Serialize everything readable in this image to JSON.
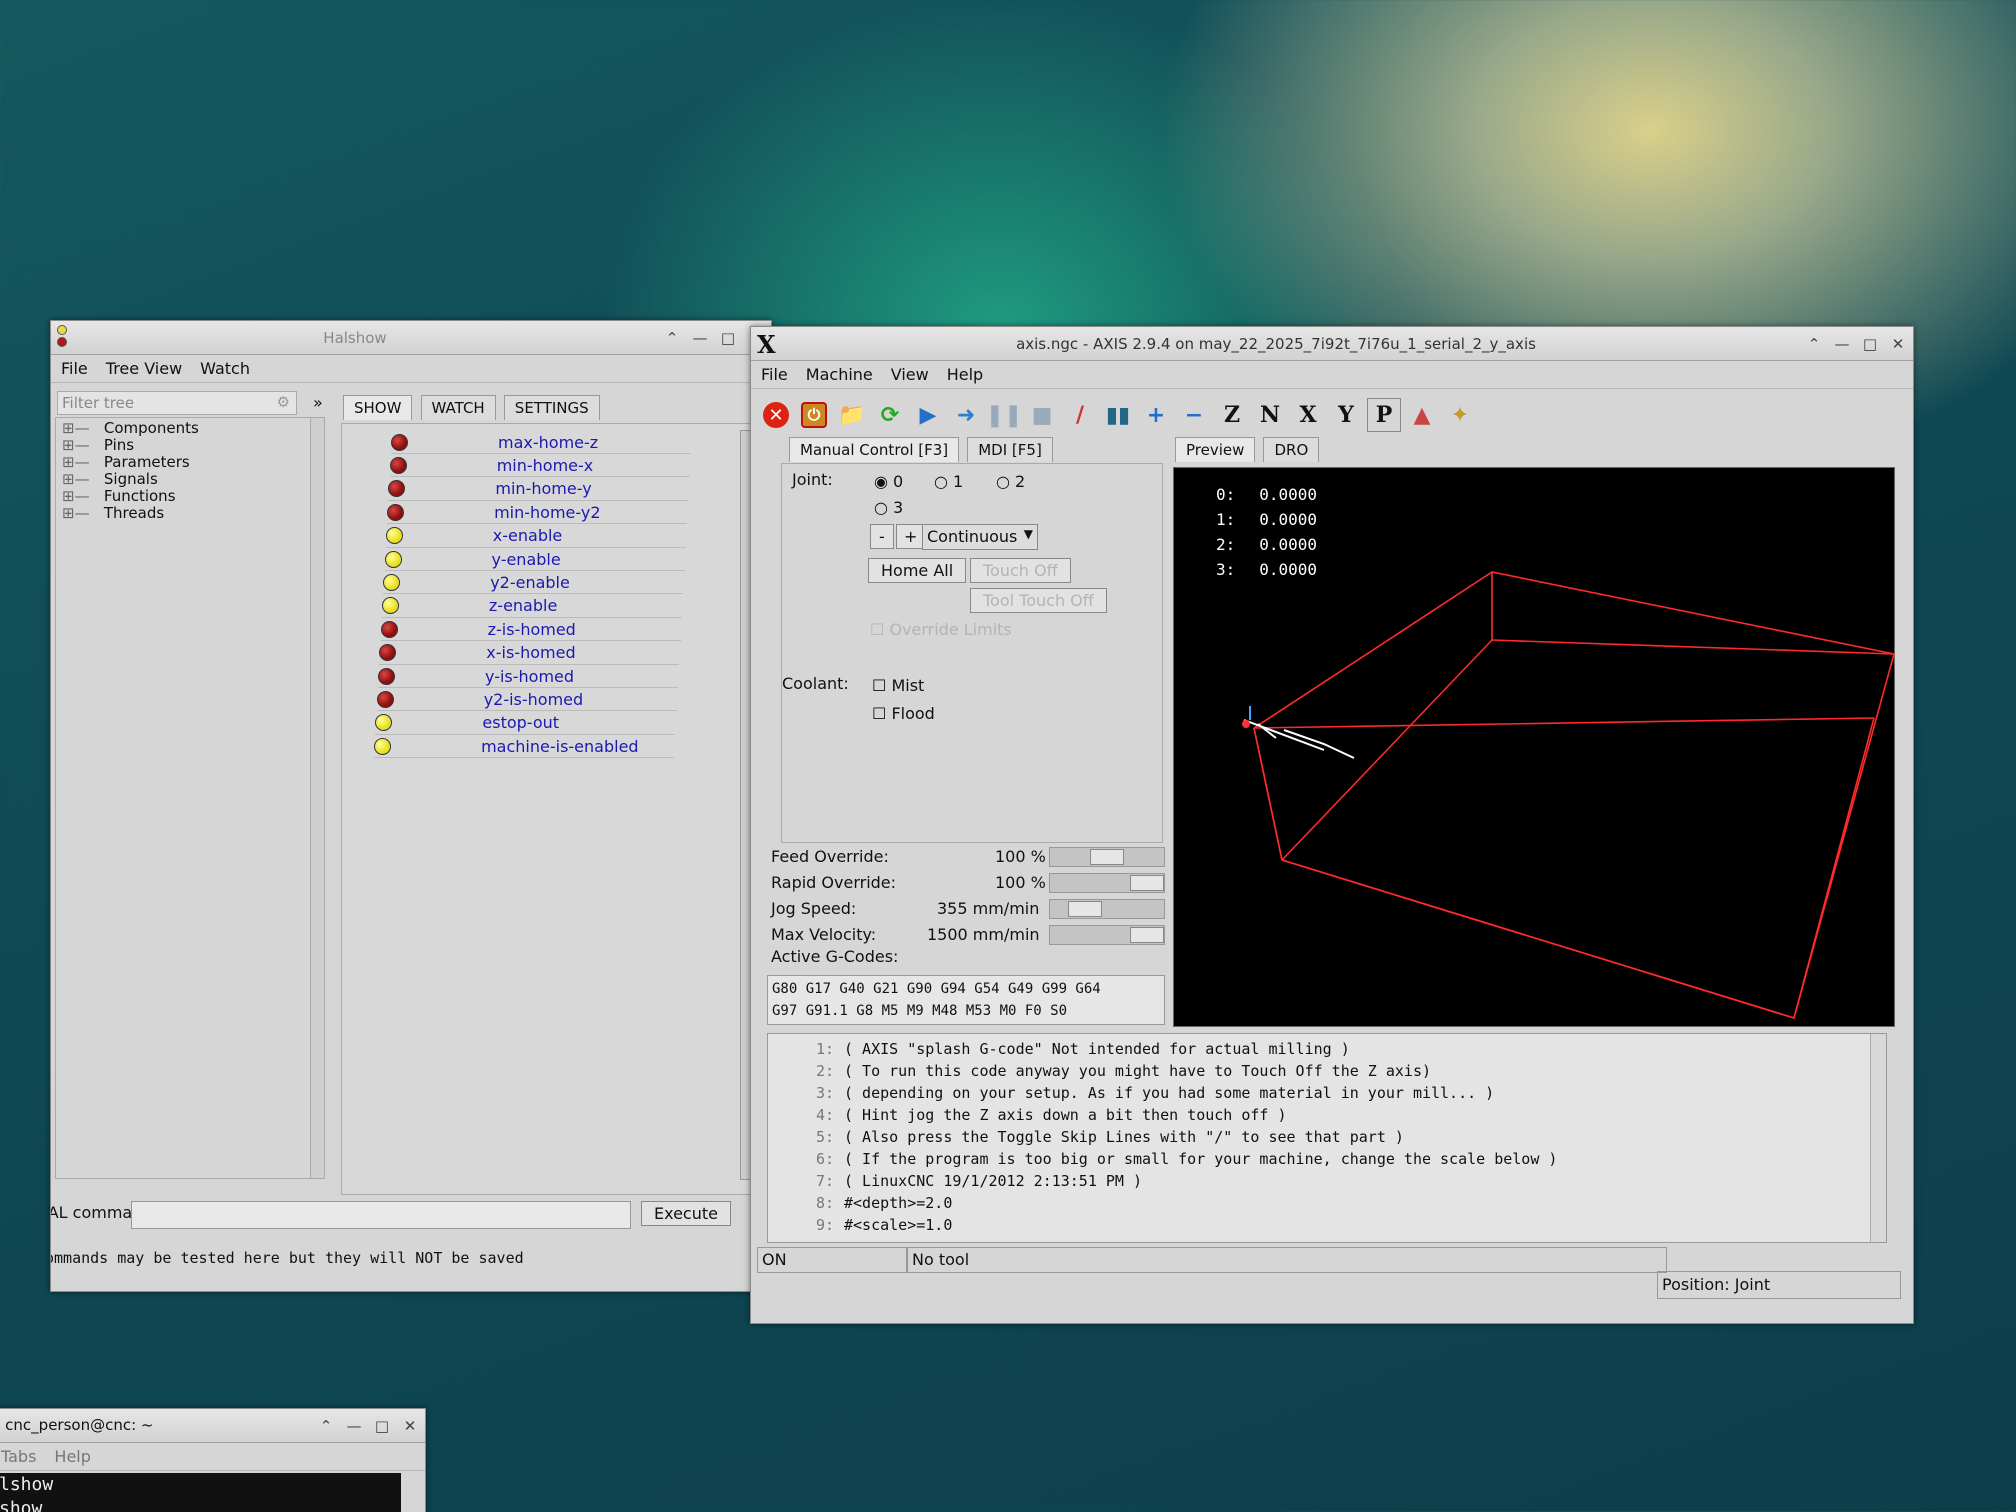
{
  "halshow": {
    "title": "Halshow",
    "menu": [
      "File",
      "Tree View",
      "Watch"
    ],
    "filter_placeholder": "Filter tree",
    "expand_glyph": "»",
    "tree": [
      "Components",
      "Pins",
      "Parameters",
      "Signals",
      "Functions",
      "Threads"
    ],
    "tabs": [
      "SHOW",
      "WATCH",
      "SETTINGS"
    ],
    "pins": [
      {
        "name": "max-home-z",
        "state": "red"
      },
      {
        "name": "min-home-x",
        "state": "red"
      },
      {
        "name": "min-home-y",
        "state": "red"
      },
      {
        "name": "min-home-y2",
        "state": "red"
      },
      {
        "name": "x-enable",
        "state": "yellow"
      },
      {
        "name": "y-enable",
        "state": "yellow"
      },
      {
        "name": "y2-enable",
        "state": "yellow"
      },
      {
        "name": "z-enable",
        "state": "yellow"
      },
      {
        "name": "z-is-homed",
        "state": "red"
      },
      {
        "name": "x-is-homed",
        "state": "red"
      },
      {
        "name": "y-is-homed",
        "state": "red"
      },
      {
        "name": "y2-is-homed",
        "state": "red"
      },
      {
        "name": "estop-out",
        "state": "yellow"
      },
      {
        "name": "machine-is-enabled",
        "state": "yellow"
      }
    ],
    "command_label": "IAL command :",
    "execute_label": "Execute",
    "status_text": "ommands may be tested here but they will NOT be saved"
  },
  "axis": {
    "title": "axis.ngc - AXIS 2.9.4 on may_22_2025_7i92t_7i76u_1_serial_2_y_axis",
    "app_glyph": "X",
    "menu": [
      "File",
      "Machine",
      "View",
      "Help"
    ],
    "tabs_left": [
      "Manual Control [F3]",
      "MDI [F5]"
    ],
    "tabs_right": [
      "Preview",
      "DRO"
    ],
    "joint_label": "Joint:",
    "joints": [
      "0",
      "1",
      "2",
      "3"
    ],
    "minus_label": "-",
    "plus_label": "+",
    "jog_mode": "Continuous",
    "home_all": "Home All",
    "touch_off": "Touch Off",
    "tool_touch_off": "Tool Touch Off",
    "override_limits": "Override Limits",
    "coolant_label": "Coolant:",
    "mist_label": "Mist",
    "flood_label": "Flood",
    "feed_override_label": "Feed Override:",
    "feed_override_value": "100 %",
    "rapid_override_label": "Rapid Override:",
    "rapid_override_value": "100 %",
    "jog_speed_label": "Jog Speed:",
    "jog_speed_value": "355 mm/min",
    "max_velocity_label": "Max Velocity:",
    "max_velocity_value": "1500 mm/min",
    "active_gcodes_label": "Active G-Codes:",
    "gcodes_line1": "G80 G17 G40 G21 G90 G94 G54 G49 G99 G64",
    "gcodes_line2": "G97 G91.1 G8 M5 M9 M48 M53 M0 F0 S0",
    "dro": [
      {
        "axis": "0:",
        "value": "0.0000"
      },
      {
        "axis": "1:",
        "value": "0.0000"
      },
      {
        "axis": "2:",
        "value": "0.0000"
      },
      {
        "axis": "3:",
        "value": "0.0000"
      }
    ],
    "gcode_lines": [
      {
        "n": "1:",
        "text": "( AXIS \"splash G-code\" Not intended for actual milling )"
      },
      {
        "n": "2:",
        "text": "( To run this code anyway you might have to Touch Off the Z axis)"
      },
      {
        "n": "3:",
        "text": "( depending on your setup. As if you had some material in your mill... )"
      },
      {
        "n": "4:",
        "text": "( Hint jog the Z axis down a bit then touch off )"
      },
      {
        "n": "5:",
        "text": "( Also press the Toggle Skip Lines with \"/\" to see that part )"
      },
      {
        "n": "6:",
        "text": "( If the program is too big or small for your machine, change the scale below )"
      },
      {
        "n": "7:",
        "text": "( LinuxCNC 19/1/2012 2:13:51 PM )"
      },
      {
        "n": "8:",
        "text": "#<depth>=2.0"
      },
      {
        "n": "9:",
        "text": "#<scale>=1.0"
      }
    ],
    "status_on": "ON",
    "status_tool": "No tool",
    "status_position": "Position: Joint"
  },
  "terminal": {
    "title": "- cnc_person@cnc: ~",
    "menu": [
      "Tabs",
      "Help"
    ],
    "lines": [
      "lshow",
      "show"
    ]
  }
}
